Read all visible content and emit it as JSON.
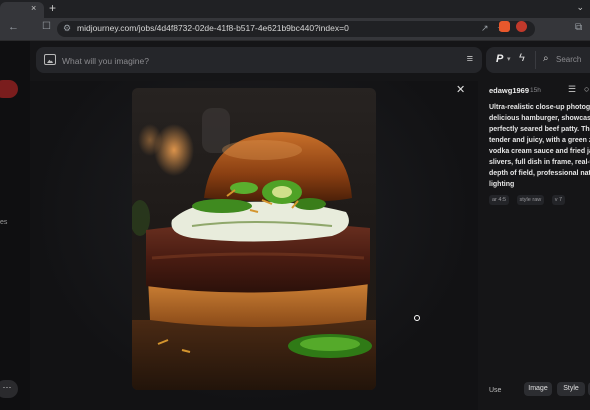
{
  "browser": {
    "url": "midjourney.com/jobs/4d4f8732-02de-41f8-b517-4e621b9bc440?index=0",
    "tab_close": "×",
    "new_tab": "+"
  },
  "search": {
    "prompt_placeholder": "What will you imagine?",
    "mode_label": "P",
    "search_placeholder": "Search"
  },
  "sidebar": {
    "partial_label": "es",
    "more_label": "···"
  },
  "job": {
    "username": "edawg1969",
    "time_ago": "15h",
    "prompt_lines": [
      "Ultra-realistic close-up photogr",
      "delicious hamburger, showcasin",
      "perfectly seared beef patty. The",
      "tender and juicy, with a green ze",
      "vodka cream sauce and fried jal",
      "slivers, full dish in frame, real-wo",
      "depth of field, professional natu",
      "lighting"
    ],
    "tags": [
      "ar 4:5",
      "style raw",
      "v 7"
    ],
    "use_label": "Use",
    "actions": [
      "Image",
      "Style"
    ]
  }
}
